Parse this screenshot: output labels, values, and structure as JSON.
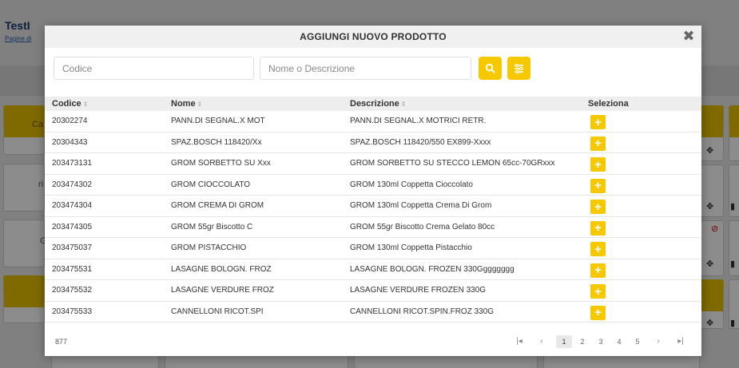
{
  "background": {
    "title": "TestI",
    "subtitle_link": "Pagine di",
    "side_text_1": "Ca",
    "side_text_2": "ri",
    "side_text_3": "G"
  },
  "modal": {
    "title": "AGGIUNGI NUOVO PRODOTTO",
    "close_icon": "close-icon",
    "search": {
      "code_placeholder": "Codice",
      "name_placeholder": "Nome o Descrizione",
      "search_icon": "search-icon",
      "filter_icon": "filter-icon"
    },
    "table": {
      "columns": [
        "Codice",
        "Nome",
        "Descrizione",
        "Seleziona"
      ],
      "rows": [
        {
          "code": "20302274",
          "name": "PANN.DI SEGNAL.X MOT",
          "desc": "PANN.DI SEGNAL.X MOTRICI RETR."
        },
        {
          "code": "20304343",
          "name": "SPAZ.BOSCH 118420/Xx",
          "desc": "SPAZ.BOSCH 118420/550 EX899-Xxxx"
        },
        {
          "code": "203473131",
          "name": "GROM SORBETTO SU Xxx",
          "desc": "GROM SORBETTO SU STECCO LEMON 65cc-70GRxxx"
        },
        {
          "code": "203474302",
          "name": "GROM CIOCCOLATO",
          "desc": "GROM 130ml Coppetta Cioccolato"
        },
        {
          "code": "203474304",
          "name": "GROM CREMA DI GROM",
          "desc": "GROM 130ml Coppetta Crema Di Grom"
        },
        {
          "code": "203474305",
          "name": "GROM 55gr Biscotto C",
          "desc": "GROM 55gr Biscotto Crema Gelato 80cc"
        },
        {
          "code": "203475037",
          "name": "GROM PISTACCHIO",
          "desc": "GROM 130ml Coppetta Pistacchio"
        },
        {
          "code": "203475531",
          "name": "LASAGNE BOLOGN. FROZ",
          "desc": "LASAGNE BOLOGN. FROZEN 330Gggggggg"
        },
        {
          "code": "203475532",
          "name": "LASAGNE VERDURE FROZ",
          "desc": "LASAGNE VERDURE FROZEN 330G"
        },
        {
          "code": "203475533",
          "name": "CANNELLONI RICOT.SPI",
          "desc": "CANNELLONI RICOT.SPIN.FROZ 330G"
        }
      ],
      "add_icon": "plus-icon"
    },
    "footer": {
      "total": "877",
      "pages": [
        "1",
        "2",
        "3",
        "4",
        "5"
      ],
      "active_page": "1",
      "first_icon": "first-page-icon",
      "prev_icon": "prev-page-icon",
      "next_icon": "next-page-icon",
      "last_icon": "last-page-icon"
    }
  },
  "colors": {
    "accent": "#f5c800",
    "header_bg": "#f0f0f0",
    "table_header_bg": "#eeeeee"
  }
}
